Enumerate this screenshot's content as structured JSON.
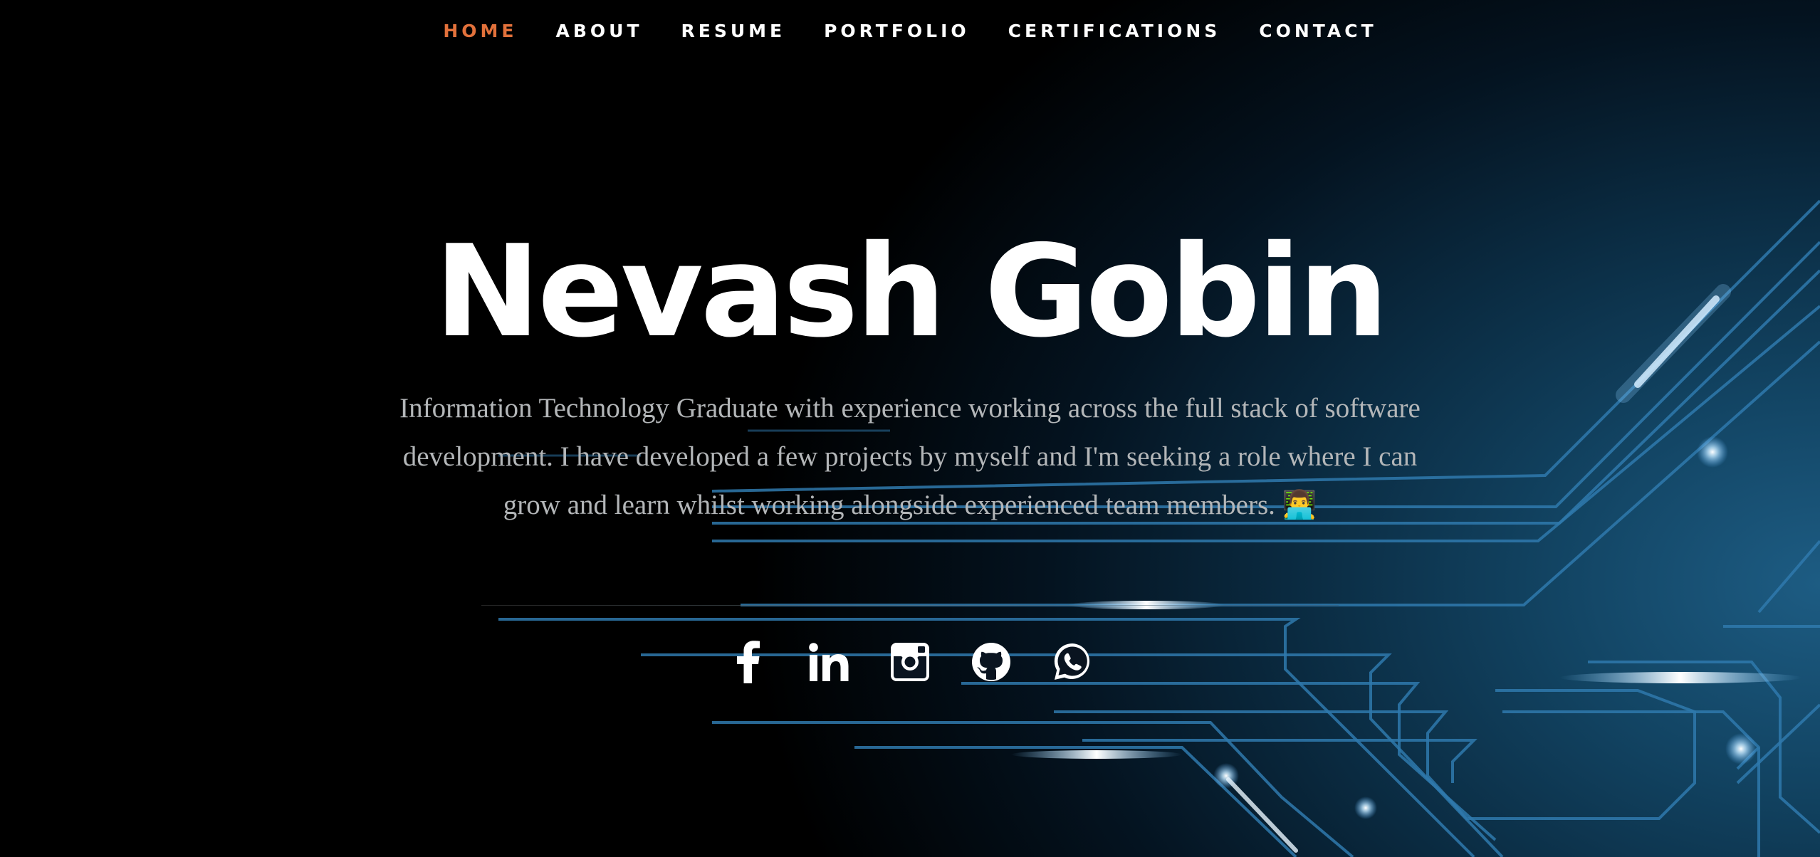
{
  "nav": {
    "items": [
      {
        "label": "HOME",
        "active": true
      },
      {
        "label": "ABOUT",
        "active": false
      },
      {
        "label": "RESUME",
        "active": false
      },
      {
        "label": "PORTFOLIO",
        "active": false
      },
      {
        "label": "CERTIFICATIONS",
        "active": false
      },
      {
        "label": "CONTACT",
        "active": false
      }
    ],
    "active_color": "#e2713b",
    "text_color": "#ffffff"
  },
  "hero": {
    "name": "Nevash Gobin",
    "description": "Information Technology Graduate with experience working across the full stack of software development. I have developed a few projects by myself and I'm seeking a role where I can grow and learn whilst working alongside experienced team members. 👨‍💻"
  },
  "social": [
    {
      "icon": "facebook-icon"
    },
    {
      "icon": "linkedin-icon"
    },
    {
      "icon": "instagram-icon"
    },
    {
      "icon": "github-icon"
    },
    {
      "icon": "whatsapp-icon"
    }
  ],
  "colors": {
    "background": "#000000",
    "circuit": "#2f79ad",
    "description_text": "#b3b6b8"
  }
}
